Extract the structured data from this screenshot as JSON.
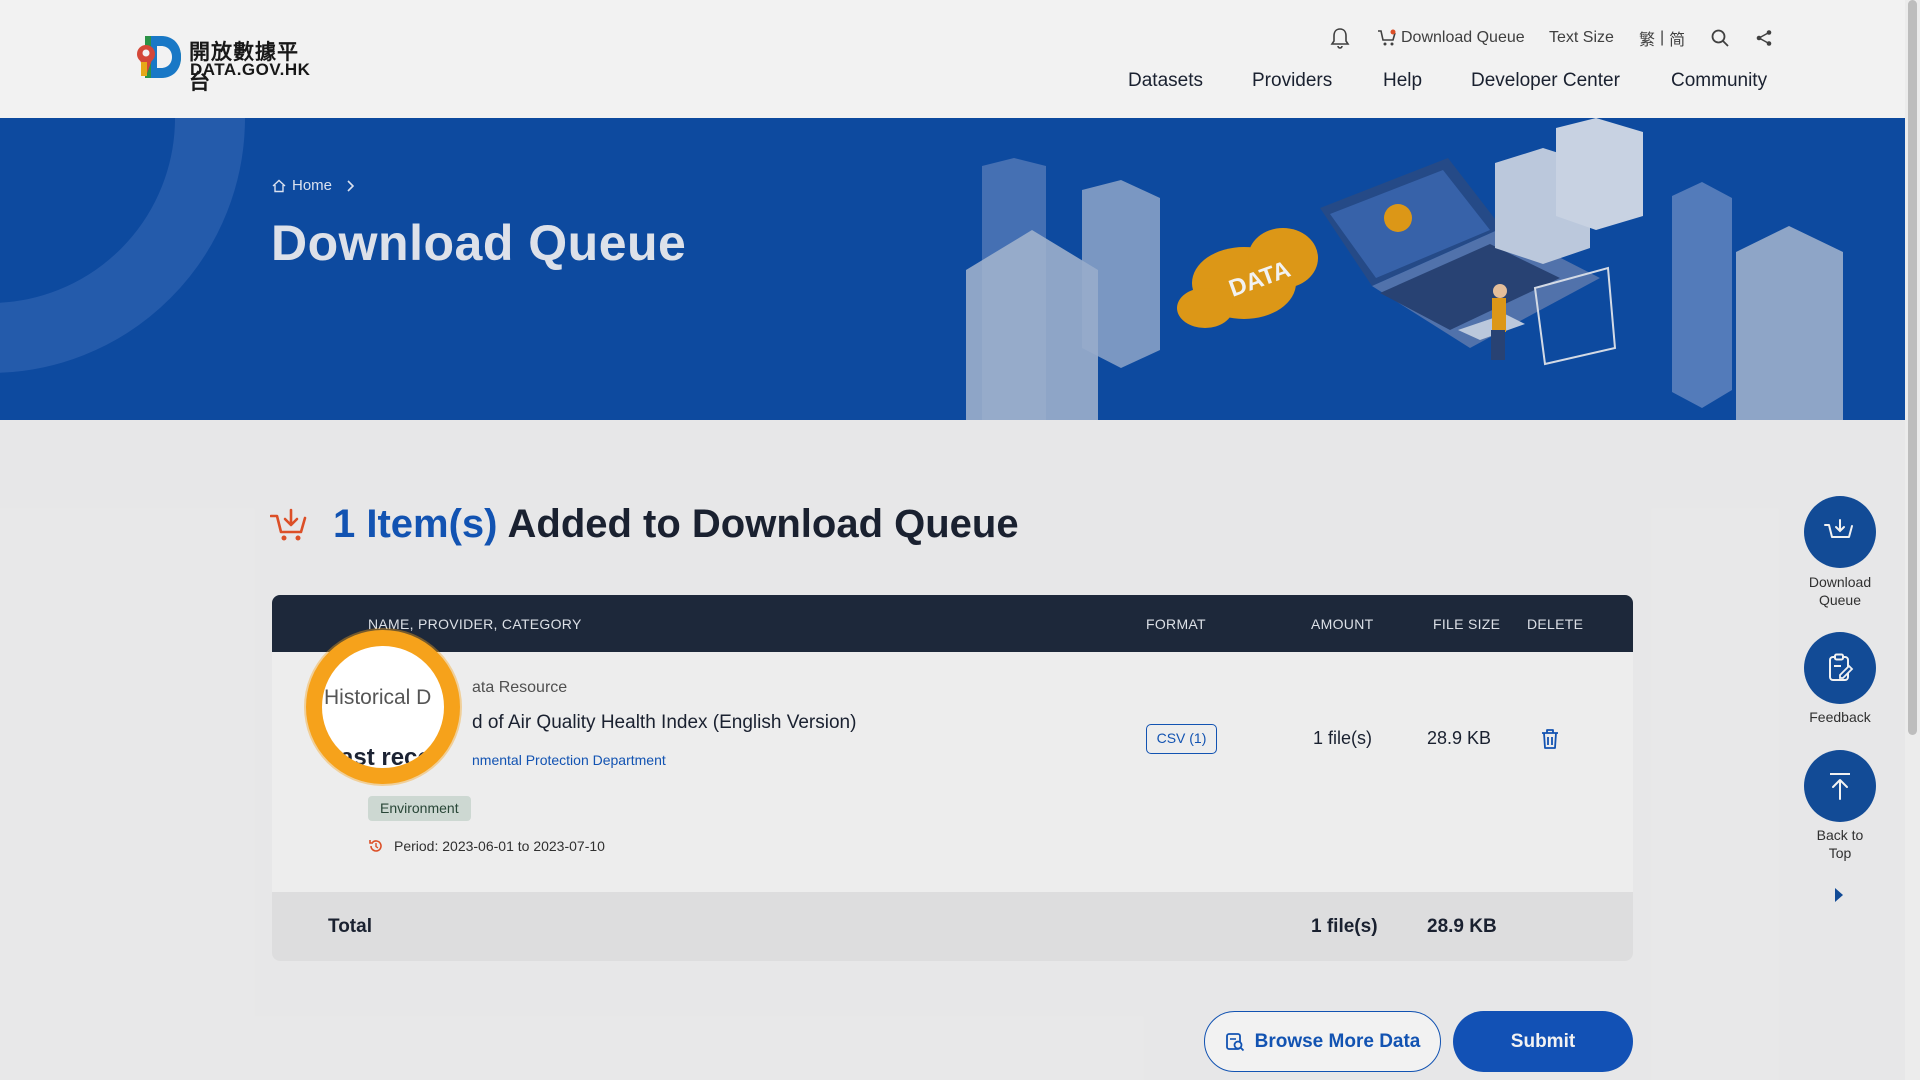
{
  "logo": {
    "zh": "開放數據平台",
    "en": "DATA.GOV.HK"
  },
  "util": {
    "notifications_icon": "bell-icon",
    "download_queue": "Download Queue",
    "text_size": "Text Size",
    "lang_trad": "繁",
    "lang_sep": "|",
    "lang_simp": "简",
    "search_icon": "search-icon",
    "share_icon": "share-icon"
  },
  "nav": [
    "Datasets",
    "Providers",
    "Help",
    "Developer Center",
    "Community"
  ],
  "breadcrumb": {
    "home": "Home"
  },
  "page_title": "Download Queue",
  "queue": {
    "count": "1 Item(s)",
    "rest": "Added to Download Queue"
  },
  "table": {
    "headers": {
      "name": "NAME, PROVIDER, CATEGORY",
      "format": "FORMAT",
      "amount": "AMOUNT",
      "size": "FILE SIZE",
      "delete": "DELETE"
    },
    "row": {
      "type": "ata Resource",
      "title": "d of Air Quality Health Index (English Version)",
      "provider": "nmental Protection Department",
      "category": "Environment",
      "period": "Period: 2023-06-01 to 2023-07-10",
      "format": "CSV (1)",
      "amount": "1 file(s)",
      "size": "28.9 KB"
    },
    "total": {
      "label": "Total",
      "amount": "1 file(s)",
      "size": "28.9 KB"
    }
  },
  "magnifier": {
    "line1": "Historical D",
    "line2": "Past reco"
  },
  "buttons": {
    "browse": "Browse More Data",
    "submit": "Submit"
  },
  "side": {
    "download_queue": [
      "Download",
      "Queue"
    ],
    "feedback": "Feedback",
    "back_to_top": [
      "Back to",
      "Top"
    ]
  },
  "colors": {
    "primary": "#1458bc",
    "banner": "#0e4ea8",
    "header_dark": "#1f2b3e",
    "accent_orange": "#e8542a",
    "highlight": "#f6a21b"
  }
}
